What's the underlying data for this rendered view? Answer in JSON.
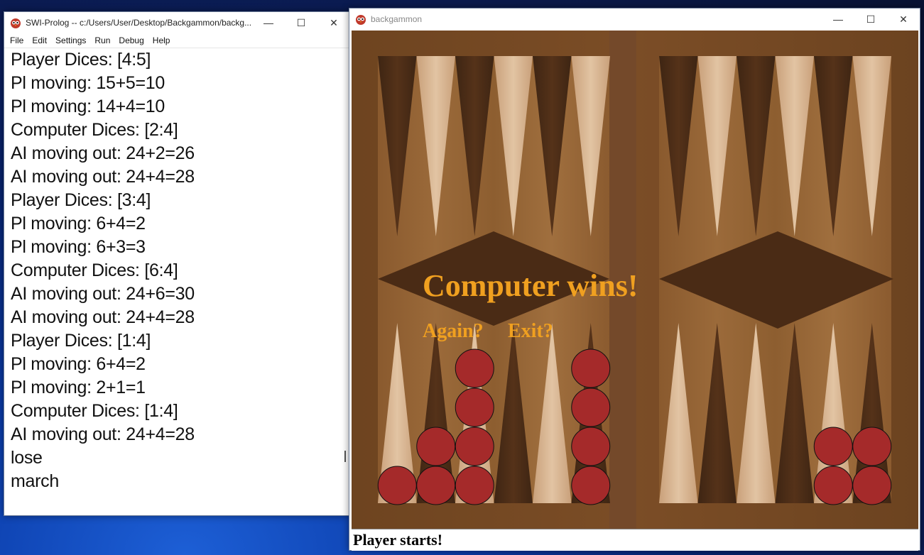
{
  "console": {
    "title": "SWI-Prolog -- c:/Users/User/Desktop/Backgammon/backg...",
    "menu": [
      "File",
      "Edit",
      "Settings",
      "Run",
      "Debug",
      "Help"
    ],
    "lines": [
      "Player Dices: [4:5]",
      "Pl moving: 15+5=10",
      "Pl moving: 14+4=10",
      "Computer Dices: [2:4]",
      "AI moving out: 24+2=26",
      "AI moving out: 24+4=28",
      "Player Dices: [3:4]",
      "Pl moving: 6+4=2",
      "Pl moving: 6+3=3",
      "Computer Dices: [6:4]",
      "AI moving out: 24+6=30",
      "AI moving out: 24+4=28",
      "Player Dices: [1:4]",
      "Pl moving: 6+4=2",
      "Pl moving: 2+1=1",
      "Computer Dices: [1:4]",
      "AI moving out: 24+4=28",
      "lose",
      "march"
    ]
  },
  "game": {
    "title": "backgammon",
    "result": "Computer wins!",
    "again": "Again?",
    "exit": "Exit?",
    "status": "Player starts!",
    "checker_color": "#a52a2a",
    "stacks": [
      {
        "point": 1,
        "count": 1
      },
      {
        "point": 2,
        "count": 2
      },
      {
        "point": 3,
        "count": 4
      },
      {
        "point": 6,
        "count": 4
      },
      {
        "point": 11,
        "count": 2
      },
      {
        "point": 12,
        "count": 2
      }
    ]
  },
  "window_controls": {
    "minimize": "—",
    "maximize": "☐",
    "close": "✕"
  }
}
